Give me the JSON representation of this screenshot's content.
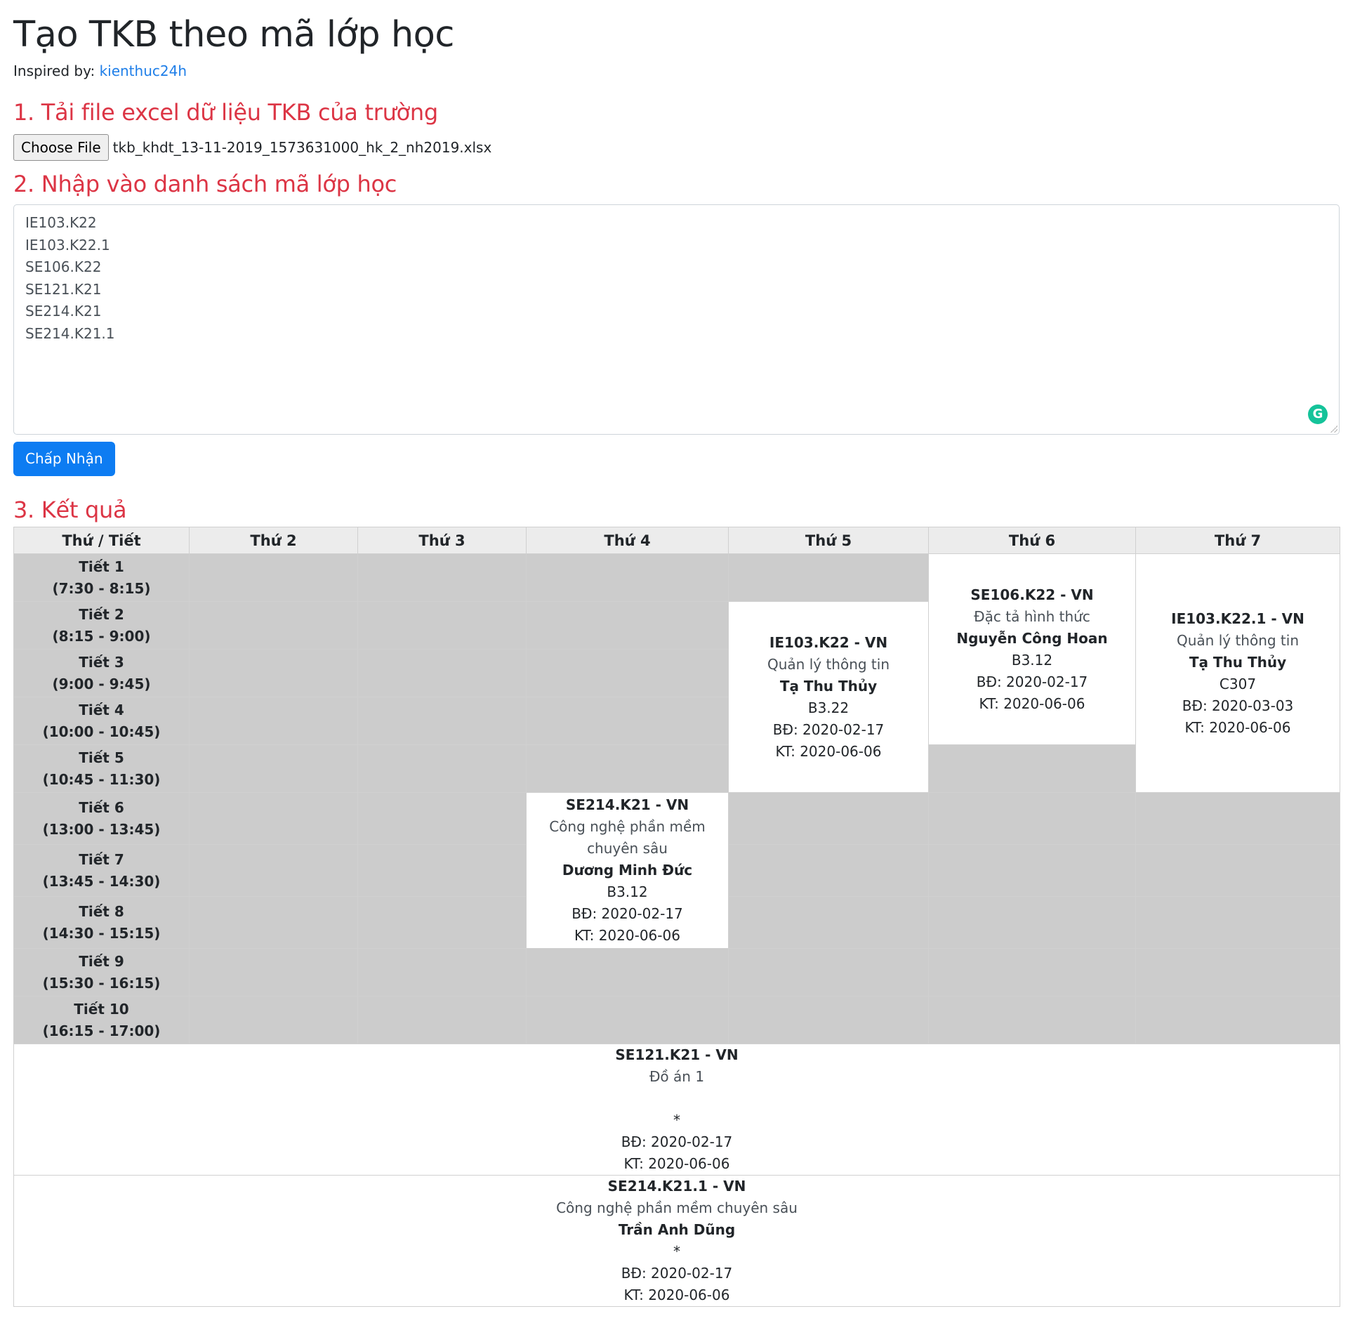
{
  "page": {
    "title": "Tạo TKB theo mã lớp học",
    "inspired_label": "Inspired by:",
    "inspired_link": "kienthuc24h"
  },
  "step1": {
    "heading": "1. Tải file excel dữ liệu TKB của trường",
    "choose_file_label": "Choose File",
    "file_name": "tkb_khdt_13-11-2019_1573631000_hk_2_nh2019.xlsx"
  },
  "step2": {
    "heading": "2. Nhập vào danh sách mã lớp học",
    "class_codes": [
      "IE103.K22",
      "IE103.K22.1",
      "SE106.K22",
      "SE121.K21",
      "SE214.K21",
      "SE214.K21.1"
    ],
    "grammarly_icon": "G",
    "accept_button": "Chấp Nhận"
  },
  "step3": {
    "heading": "3. Kết quả",
    "table": {
      "header": [
        "Thứ / Tiết",
        "Thứ 2",
        "Thứ 3",
        "Thứ 4",
        "Thứ 5",
        "Thứ 6",
        "Thứ 7"
      ],
      "periods": [
        {
          "name": "Tiết 1",
          "time": "(7:30 - 8:15)"
        },
        {
          "name": "Tiết 2",
          "time": "(8:15 - 9:00)"
        },
        {
          "name": "Tiết 3",
          "time": "(9:00 - 9:45)"
        },
        {
          "name": "Tiết 4",
          "time": "(10:00 - 10:45)"
        },
        {
          "name": "Tiết 5",
          "time": "(10:45 - 11:30)"
        },
        {
          "name": "Tiết 6",
          "time": "(13:00 - 13:45)"
        },
        {
          "name": "Tiết 7",
          "time": "(13:45 - 14:30)"
        },
        {
          "name": "Tiết 8",
          "time": "(14:30 - 15:15)"
        },
        {
          "name": "Tiết 9",
          "time": "(15:30 - 16:15)"
        },
        {
          "name": "Tiết 10",
          "time": "(16:15 - 17:00)"
        }
      ],
      "classes": {
        "thu5": {
          "code": "IE103.K22 - VN",
          "name": "Quản lý thông tin",
          "teacher": "Tạ Thu Thủy",
          "room": "B3.22",
          "start": "BĐ: 2020-02-17",
          "end": "KT: 2020-06-06"
        },
        "thu6": {
          "code": "SE106.K22 - VN",
          "name": "Đặc tả hình thức",
          "teacher": "Nguyễn Công Hoan",
          "room": "B3.12",
          "start": "BĐ: 2020-02-17",
          "end": "KT: 2020-06-06"
        },
        "thu7": {
          "code": "IE103.K22.1 - VN",
          "name": "Quản lý thông tin",
          "teacher": "Tạ Thu Thủy",
          "room": "C307",
          "start": "BĐ: 2020-03-03",
          "end": "KT: 2020-06-06"
        },
        "thu4": {
          "code": "SE214.K21 - VN",
          "name": "Công nghệ phần mềm chuyên sâu",
          "teacher": "Dương Minh Đức",
          "room": "B3.12",
          "start": "BĐ: 2020-02-17",
          "end": "KT: 2020-06-06"
        }
      },
      "unscheduled": [
        {
          "code": "SE121.K21 - VN",
          "name": "Đồ án 1",
          "teacher": "",
          "room": "*",
          "start": "BĐ: 2020-02-17",
          "end": "KT: 2020-06-06"
        },
        {
          "code": "SE214.K21.1 - VN",
          "name": "Công nghệ phần mềm chuyên sâu",
          "teacher": "Trần Anh Dũng",
          "room": "*",
          "start": "BĐ: 2020-02-17",
          "end": "KT: 2020-06-06"
        }
      ]
    }
  },
  "colors": {
    "heading_red": "#dc3545",
    "link_blue": "#1e7ee8",
    "button_blue": "#0d7cf2",
    "empty_cell_gray": "#cccccc",
    "header_gray": "#ececec",
    "grammarly_green": "#15c39a"
  }
}
